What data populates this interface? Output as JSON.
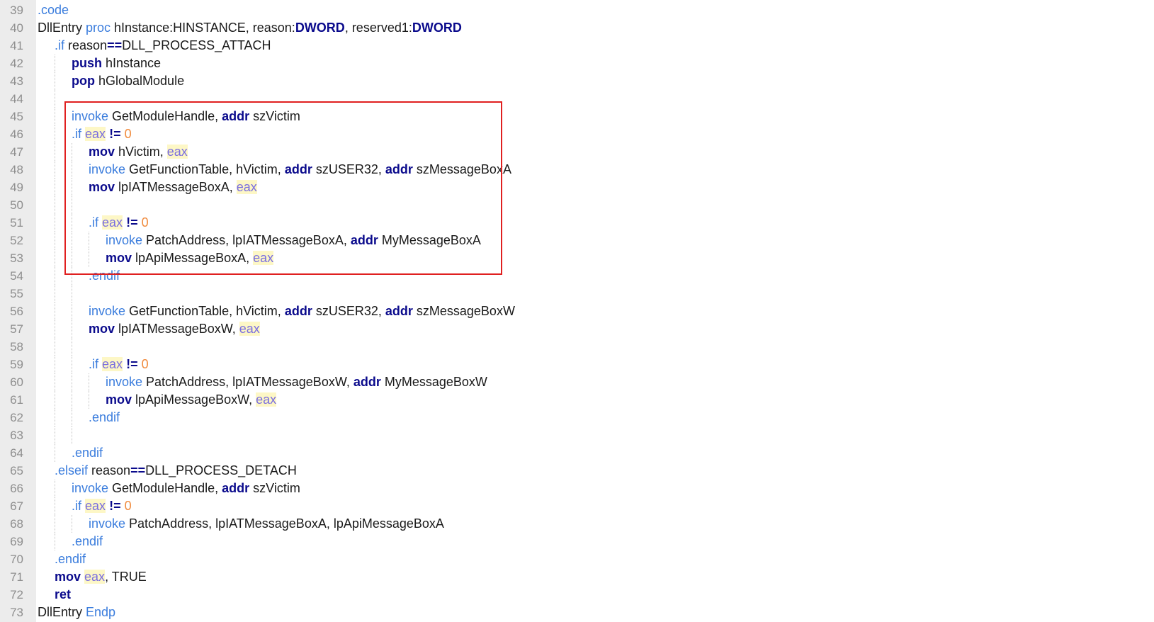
{
  "editor": {
    "highlight": {
      "from_line": "45",
      "to_line": "54",
      "color": "#e02020"
    },
    "colors": {
      "keyword": "#0a0a8c",
      "directive": "#3b7ddd",
      "number": "#f08a3c",
      "register": "#7a6ee0",
      "register_bg": "#fdf7c6",
      "line_number": "#8e8e8e",
      "gutter_bg": "#ececec"
    },
    "lines": [
      {
        "num": "39",
        "indent": 0,
        "tokens": [
          {
            "t": ".code",
            "k": "dir"
          }
        ]
      },
      {
        "num": "40",
        "indent": 0,
        "tokens": [
          {
            "t": "DllEntry ",
            "k": "plain"
          },
          {
            "t": "proc",
            "k": "dir"
          },
          {
            "t": " hInstance:HINSTANCE, reason:",
            "k": "plain"
          },
          {
            "t": "DWORD",
            "k": "kw"
          },
          {
            "t": ", reserved1:",
            "k": "plain"
          },
          {
            "t": "DWORD",
            "k": "kw"
          }
        ]
      },
      {
        "num": "41",
        "indent": 1,
        "tokens": [
          {
            "t": ".if",
            "k": "dir"
          },
          {
            "t": " reason",
            "k": "plain"
          },
          {
            "t": "==",
            "k": "kw"
          },
          {
            "t": "DLL_PROCESS_ATTACH",
            "k": "plain"
          }
        ]
      },
      {
        "num": "42",
        "indent": 2,
        "tokens": [
          {
            "t": "push",
            "k": "kw"
          },
          {
            "t": " hInstance",
            "k": "plain"
          }
        ]
      },
      {
        "num": "43",
        "indent": 2,
        "tokens": [
          {
            "t": "pop",
            "k": "kw"
          },
          {
            "t": " hGlobalModule",
            "k": "plain"
          }
        ]
      },
      {
        "num": "44",
        "indent": 2,
        "tokens": []
      },
      {
        "num": "45",
        "indent": 2,
        "tokens": [
          {
            "t": "invoke",
            "k": "dir"
          },
          {
            "t": " GetModuleHandle, ",
            "k": "plain"
          },
          {
            "t": "addr",
            "k": "kw"
          },
          {
            "t": " szVictim",
            "k": "plain"
          }
        ]
      },
      {
        "num": "46",
        "indent": 2,
        "tokens": [
          {
            "t": ".if",
            "k": "dir"
          },
          {
            "t": " ",
            "k": "plain"
          },
          {
            "t": "eax",
            "k": "reg"
          },
          {
            "t": " ",
            "k": "plain"
          },
          {
            "t": "!=",
            "k": "kw"
          },
          {
            "t": " ",
            "k": "plain"
          },
          {
            "t": "0",
            "k": "num"
          }
        ]
      },
      {
        "num": "47",
        "indent": 3,
        "tokens": [
          {
            "t": "mov",
            "k": "kw"
          },
          {
            "t": " hVictim, ",
            "k": "plain"
          },
          {
            "t": "eax",
            "k": "reg"
          }
        ]
      },
      {
        "num": "48",
        "indent": 3,
        "tokens": [
          {
            "t": "invoke",
            "k": "dir"
          },
          {
            "t": " GetFunctionTable, hVictim, ",
            "k": "plain"
          },
          {
            "t": "addr",
            "k": "kw"
          },
          {
            "t": " szUSER32, ",
            "k": "plain"
          },
          {
            "t": "addr",
            "k": "kw"
          },
          {
            "t": " szMessageBoxA",
            "k": "plain"
          }
        ]
      },
      {
        "num": "49",
        "indent": 3,
        "tokens": [
          {
            "t": "mov",
            "k": "kw"
          },
          {
            "t": " lpIATMessageBoxA, ",
            "k": "plain"
          },
          {
            "t": "eax",
            "k": "reg"
          }
        ]
      },
      {
        "num": "50",
        "indent": 3,
        "tokens": []
      },
      {
        "num": "51",
        "indent": 3,
        "tokens": [
          {
            "t": ".if",
            "k": "dir"
          },
          {
            "t": " ",
            "k": "plain"
          },
          {
            "t": "eax",
            "k": "reg"
          },
          {
            "t": " ",
            "k": "plain"
          },
          {
            "t": "!=",
            "k": "kw"
          },
          {
            "t": " ",
            "k": "plain"
          },
          {
            "t": "0",
            "k": "num"
          }
        ]
      },
      {
        "num": "52",
        "indent": 4,
        "tokens": [
          {
            "t": "invoke",
            "k": "dir"
          },
          {
            "t": " PatchAddress, lpIATMessageBoxA, ",
            "k": "plain"
          },
          {
            "t": "addr",
            "k": "kw"
          },
          {
            "t": " MyMessageBoxA",
            "k": "plain"
          }
        ]
      },
      {
        "num": "53",
        "indent": 4,
        "tokens": [
          {
            "t": "mov",
            "k": "kw"
          },
          {
            "t": " lpApiMessageBoxA, ",
            "k": "plain"
          },
          {
            "t": "eax",
            "k": "reg"
          }
        ]
      },
      {
        "num": "54",
        "indent": 3,
        "tokens": [
          {
            "t": ".endif",
            "k": "dir"
          }
        ]
      },
      {
        "num": "55",
        "indent": 3,
        "tokens": []
      },
      {
        "num": "56",
        "indent": 3,
        "tokens": [
          {
            "t": "invoke",
            "k": "dir"
          },
          {
            "t": " GetFunctionTable, hVictim, ",
            "k": "plain"
          },
          {
            "t": "addr",
            "k": "kw"
          },
          {
            "t": " szUSER32, ",
            "k": "plain"
          },
          {
            "t": "addr",
            "k": "kw"
          },
          {
            "t": " szMessageBoxW",
            "k": "plain"
          }
        ]
      },
      {
        "num": "57",
        "indent": 3,
        "tokens": [
          {
            "t": "mov",
            "k": "kw"
          },
          {
            "t": " lpIATMessageBoxW, ",
            "k": "plain"
          },
          {
            "t": "eax",
            "k": "reg"
          }
        ]
      },
      {
        "num": "58",
        "indent": 3,
        "tokens": []
      },
      {
        "num": "59",
        "indent": 3,
        "tokens": [
          {
            "t": ".if",
            "k": "dir"
          },
          {
            "t": " ",
            "k": "plain"
          },
          {
            "t": "eax",
            "k": "reg"
          },
          {
            "t": " ",
            "k": "plain"
          },
          {
            "t": "!=",
            "k": "kw"
          },
          {
            "t": " ",
            "k": "plain"
          },
          {
            "t": "0",
            "k": "num"
          }
        ]
      },
      {
        "num": "60",
        "indent": 4,
        "tokens": [
          {
            "t": "invoke",
            "k": "dir"
          },
          {
            "t": " PatchAddress, lpIATMessageBoxW, ",
            "k": "plain"
          },
          {
            "t": "addr",
            "k": "kw"
          },
          {
            "t": " MyMessageBoxW",
            "k": "plain"
          }
        ]
      },
      {
        "num": "61",
        "indent": 4,
        "tokens": [
          {
            "t": "mov",
            "k": "kw"
          },
          {
            "t": " lpApiMessageBoxW, ",
            "k": "plain"
          },
          {
            "t": "eax",
            "k": "reg"
          }
        ]
      },
      {
        "num": "62",
        "indent": 3,
        "tokens": [
          {
            "t": ".endif",
            "k": "dir"
          }
        ]
      },
      {
        "num": "63",
        "indent": 3,
        "tokens": []
      },
      {
        "num": "64",
        "indent": 2,
        "tokens": [
          {
            "t": ".endif",
            "k": "dir"
          }
        ]
      },
      {
        "num": "65",
        "indent": 1,
        "tokens": [
          {
            "t": ".elseif",
            "k": "dir"
          },
          {
            "t": " reason",
            "k": "plain"
          },
          {
            "t": "==",
            "k": "kw"
          },
          {
            "t": "DLL_PROCESS_DETACH",
            "k": "plain"
          }
        ]
      },
      {
        "num": "66",
        "indent": 2,
        "tokens": [
          {
            "t": "invoke",
            "k": "dir"
          },
          {
            "t": " GetModuleHandle, ",
            "k": "plain"
          },
          {
            "t": "addr",
            "k": "kw"
          },
          {
            "t": " szVictim",
            "k": "plain"
          }
        ]
      },
      {
        "num": "67",
        "indent": 2,
        "tokens": [
          {
            "t": ".if",
            "k": "dir"
          },
          {
            "t": " ",
            "k": "plain"
          },
          {
            "t": "eax",
            "k": "reg"
          },
          {
            "t": " ",
            "k": "plain"
          },
          {
            "t": "!=",
            "k": "kw"
          },
          {
            "t": " ",
            "k": "plain"
          },
          {
            "t": "0",
            "k": "num"
          }
        ]
      },
      {
        "num": "68",
        "indent": 3,
        "tokens": [
          {
            "t": "invoke",
            "k": "dir"
          },
          {
            "t": " PatchAddress, lpIATMessageBoxA, lpApiMessageBoxA",
            "k": "plain"
          }
        ]
      },
      {
        "num": "69",
        "indent": 2,
        "tokens": [
          {
            "t": ".endif",
            "k": "dir"
          }
        ]
      },
      {
        "num": "70",
        "indent": 1,
        "tokens": [
          {
            "t": ".endif",
            "k": "dir"
          }
        ]
      },
      {
        "num": "71",
        "indent": 1,
        "tokens": [
          {
            "t": "mov",
            "k": "kw"
          },
          {
            "t": " ",
            "k": "plain"
          },
          {
            "t": "eax",
            "k": "reg"
          },
          {
            "t": ", TRUE",
            "k": "plain"
          }
        ]
      },
      {
        "num": "72",
        "indent": 1,
        "tokens": [
          {
            "t": "ret",
            "k": "kw"
          }
        ]
      },
      {
        "num": "73",
        "indent": 0,
        "tokens": [
          {
            "t": "DllEntry ",
            "k": "plain"
          },
          {
            "t": "Endp",
            "k": "dir"
          }
        ]
      }
    ]
  }
}
